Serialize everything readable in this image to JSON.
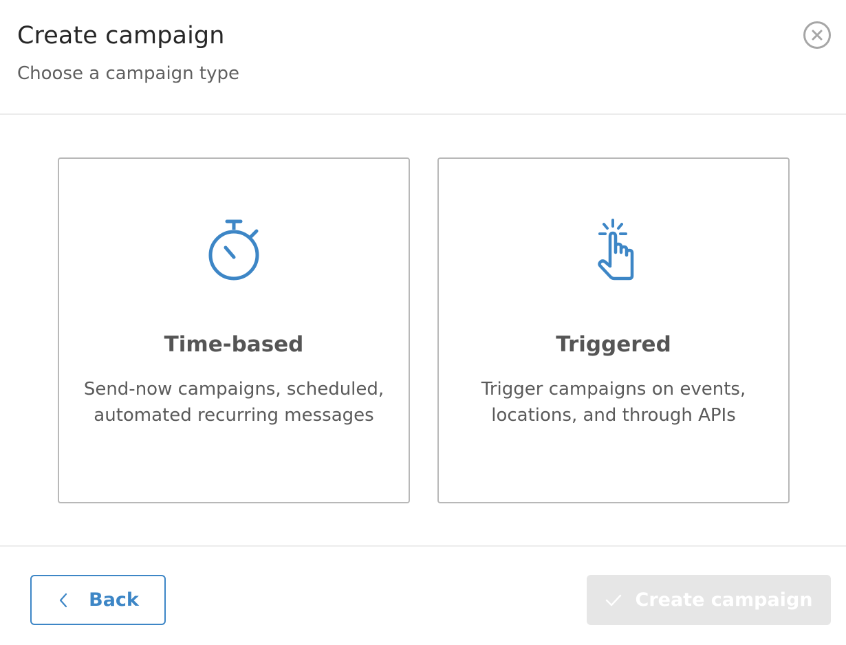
{
  "header": {
    "title": "Create campaign",
    "subtitle": "Choose a campaign type"
  },
  "cards": [
    {
      "icon": "stopwatch-icon",
      "title": "Time-based",
      "description": "Send-now campaigns, scheduled, automated recurring messages"
    },
    {
      "icon": "tap-finger-icon",
      "title": "Triggered",
      "description": "Trigger campaigns on events, locations, and through APIs"
    }
  ],
  "footer": {
    "back_label": "Back",
    "create_label": "Create campaign",
    "create_disabled": true
  },
  "colors": {
    "accent": "#3d86c6",
    "disabled_bg": "#e6e6e6",
    "border": "#b8b8b8"
  }
}
